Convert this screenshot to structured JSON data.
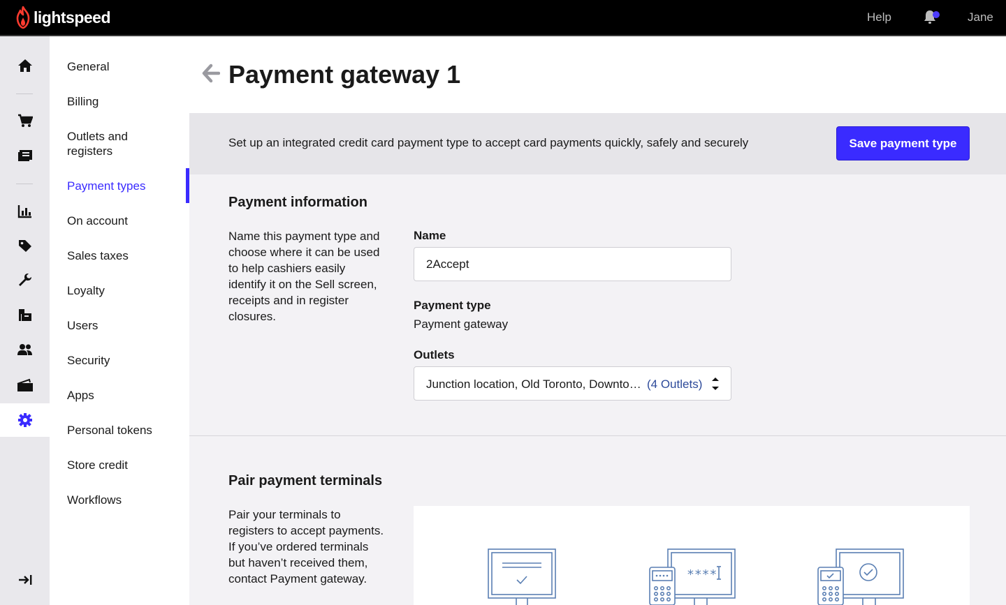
{
  "topbar": {
    "brand": "lightspeed",
    "help_label": "Help",
    "notification_icon": "bell-icon",
    "user_label": "Jane",
    "accent": "#4d3cff"
  },
  "rail": {
    "items": [
      {
        "icon": "home-icon"
      },
      {
        "icon": "cart-icon"
      },
      {
        "icon": "register-icon"
      },
      {
        "icon": "reports-icon"
      },
      {
        "icon": "tag-icon"
      },
      {
        "icon": "wrench-icon"
      },
      {
        "icon": "inventory-icon"
      },
      {
        "icon": "customers-icon"
      },
      {
        "icon": "wallet-icon"
      },
      {
        "icon": "gear-icon",
        "active": true
      },
      {
        "icon": "collapse-sidebar-icon"
      }
    ]
  },
  "subnav": {
    "items": [
      {
        "label": "General"
      },
      {
        "label": "Billing"
      },
      {
        "label": "Outlets and registers"
      },
      {
        "label": "Payment types",
        "active": true
      },
      {
        "label": "On account"
      },
      {
        "label": "Sales taxes"
      },
      {
        "label": "Loyalty"
      },
      {
        "label": "Users"
      },
      {
        "label": "Security"
      },
      {
        "label": "Apps"
      },
      {
        "label": "Personal tokens"
      },
      {
        "label": "Store credit"
      },
      {
        "label": "Workflows"
      }
    ]
  },
  "page": {
    "title": "Payment gateway 1",
    "back_icon": "arrow-left-icon",
    "description": "Set up an integrated credit card payment type to accept card payments quickly, safely and securely",
    "save_label": "Save payment type",
    "primary_color": "#3a2bff"
  },
  "payment_info": {
    "title": "Payment information",
    "description": "Name this payment type and choose where it can be used to help cashiers easily identify it on the Sell screen, receipts and in register closures.",
    "name_label": "Name",
    "name_value": "2Accept",
    "type_label": "Payment type",
    "type_value": "Payment gateway",
    "outlets_label": "Outlets",
    "outlets_value": "Junction location, Old Toronto, Downto…",
    "outlets_count": "(4 Outlets)"
  },
  "terminals": {
    "title": "Pair payment terminals",
    "description": "Pair your terminals to registers to accept payments. If you’ve ordered terminals but haven’t received them, contact Payment gateway.",
    "illustration_pin_text": "****",
    "illustrations": [
      "register-screen-icon",
      "card-terminal-pin-icon",
      "card-terminal-check-icon"
    ]
  }
}
